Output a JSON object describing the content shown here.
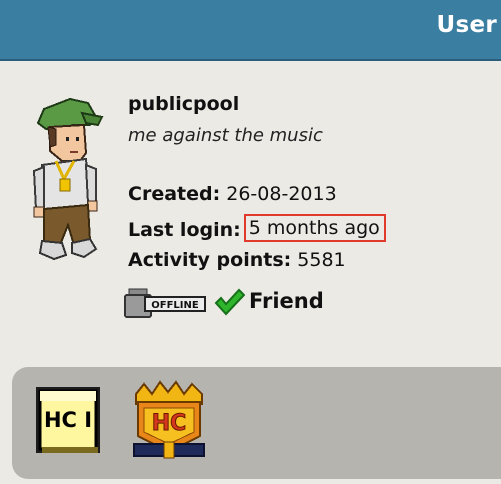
{
  "header": {
    "title": "User"
  },
  "profile": {
    "username": "publicpool",
    "motto": "me against the music",
    "created_label": "Created:",
    "created_value": "26-08-2013",
    "last_login_label": "Last login:",
    "last_login_value": "5 months ago",
    "activity_label": "Activity points:",
    "activity_value": "5581",
    "status_text": "OFFLINE",
    "friend_label": "Friend"
  },
  "badges": [
    {
      "icon": "hc1-badge-icon",
      "text": "HC I"
    },
    {
      "icon": "hc-crown-badge-icon",
      "text": "HC"
    }
  ],
  "colors": {
    "header": "#3a7ea1",
    "background": "#e9e8e3",
    "highlight": "#e03a2a",
    "badge_strip": "#b5b4ae",
    "check": "#2fb52b"
  }
}
